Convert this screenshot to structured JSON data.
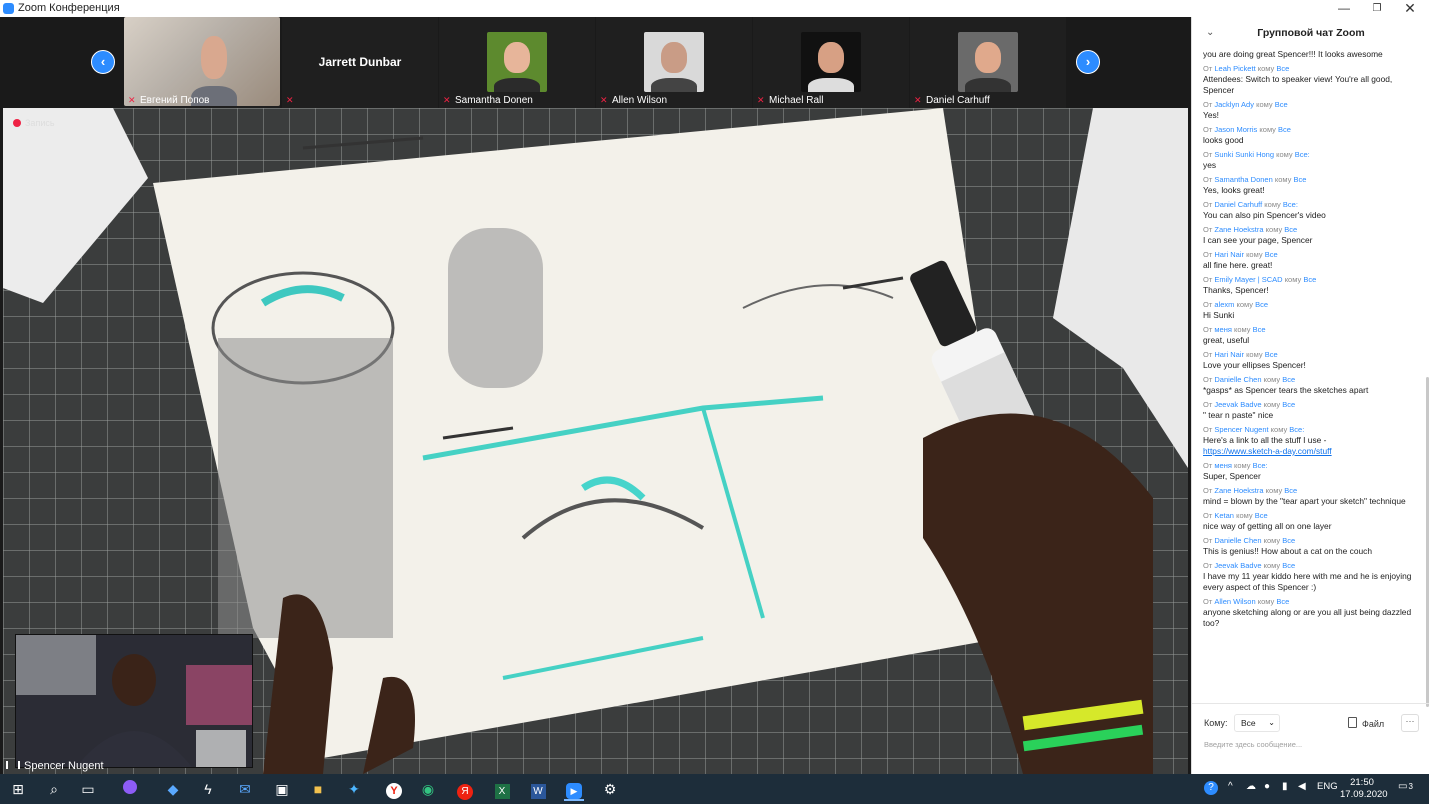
{
  "window": {
    "title": "Zoom Конференция",
    "minimize": "—",
    "maximize": "❐",
    "close": "✕"
  },
  "gallery": {
    "tiles": [
      {
        "name": "Евгений Попов"
      },
      {
        "name": "Jarrett Dunbar"
      },
      {
        "name": "Samantha Donen"
      },
      {
        "name": "Allen Wilson"
      },
      {
        "name": "Michael Rall"
      },
      {
        "name": "Daniel Carhuff"
      }
    ]
  },
  "main": {
    "recording_label": "Запись",
    "speaker_name": "Spencer Nugent"
  },
  "chat": {
    "title": "Групповой чат Zoom",
    "from_prefix": "От",
    "to_word": "кому",
    "first_line": "you are doing great Spencer!!! It looks awesome",
    "messages": [
      {
        "from": "Leah Pickett",
        "to": "Все",
        "text": "Attendees: Switch to speaker view! You're all good, Spencer"
      },
      {
        "from": "Jacklyn Ady",
        "to": "Все",
        "text": "Yes!"
      },
      {
        "from": "Jason Morris",
        "to": "Все",
        "text": "looks good"
      },
      {
        "from": "Sunki Sunki Hong",
        "to": "Все:",
        "text": "yes"
      },
      {
        "from": "Samantha Donen",
        "to": "Все",
        "text": "Yes, looks great!"
      },
      {
        "from": "Daniel Carhuff",
        "to": "Все:",
        "text": "You can also pin Spencer's video"
      },
      {
        "from": "Zane Hoekstra",
        "to": "Все",
        "text": "I can see your page, Spencer"
      },
      {
        "from": "Hari Nair",
        "to": "Все",
        "text": "all fine here. great!"
      },
      {
        "from": "Emily Mayer | SCAD",
        "to": "Все",
        "text": "Thanks, Spencer!"
      },
      {
        "from": "alexm",
        "to": "Все",
        "text": "Hi Sunki"
      },
      {
        "from": "меня",
        "to": "Все",
        "text": "great, useful"
      },
      {
        "from": "Hari Nair",
        "to": "Все",
        "text": "Love your ellipses Spencer!"
      },
      {
        "from": "Danielle Chen",
        "to": "Все",
        "text": "*gasps* as Spencer tears the sketches apart"
      },
      {
        "from": "Jeevak Badve",
        "to": "Все",
        "text": "\" tear n paste\" nice"
      },
      {
        "from": "Spencer Nugent",
        "to": "Все:",
        "text": "Here's a link to all the stuff I use -",
        "link": "https://www.sketch-a-day.com/stuff"
      },
      {
        "from": "меня",
        "to": "Все:",
        "text": "Super, Spencer"
      },
      {
        "from": "Zane Hoekstra",
        "to": "Все",
        "text": "mind = blown by the \"tear apart your sketch\" technique"
      },
      {
        "from": "Ketan",
        "to": "Все",
        "text": "nice way of getting all on one layer"
      },
      {
        "from": "Danielle Chen",
        "to": "Все",
        "text": "This is genius!! How about a cat on the couch"
      },
      {
        "from": "Jeevak Badve",
        "to": "Все",
        "text": "I have my 11 year kiddo here with me and he is enjoying every aspect of this Spencer :)"
      },
      {
        "from": "Allen Wilson",
        "to": "Все",
        "text": "anyone sketching along or are you all just being dazzled too?"
      }
    ],
    "to_label": "Кому:",
    "recipient": "Все",
    "file_label": "Файл",
    "more_label": "···",
    "input_placeholder": "Введите здесь сообщение..."
  },
  "taskbar": {
    "lang": "ENG",
    "time": "21:50",
    "date": "17.09.2020",
    "notifications": "3"
  }
}
